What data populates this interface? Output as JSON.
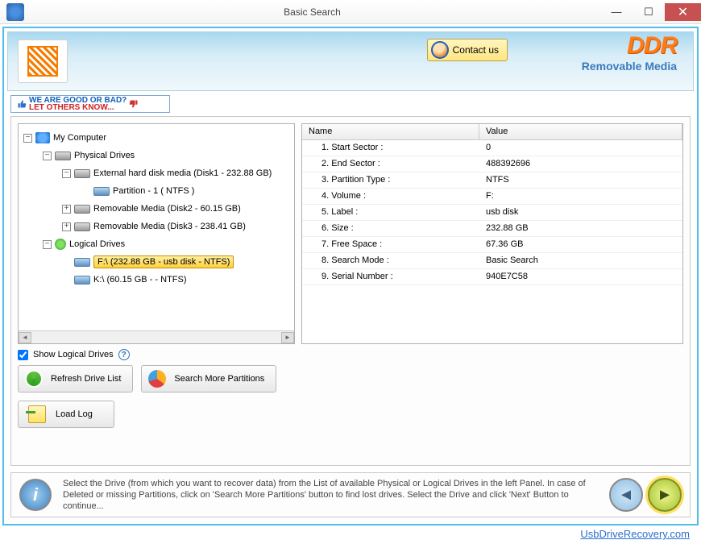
{
  "window": {
    "title": "Basic Search"
  },
  "header": {
    "contact_label": "Contact us",
    "brand": "DDR",
    "brand_sub": "Removable Media"
  },
  "feedback": {
    "line1": "WE ARE GOOD OR BAD?",
    "line2": "LET OTHERS KNOW..."
  },
  "tree": {
    "root": "My Computer",
    "physical": "Physical Drives",
    "disk1": "External hard disk media (Disk1 - 232.88 GB)",
    "disk1_part": "Partition - 1 ( NTFS )",
    "disk2": "Removable Media (Disk2 - 60.15 GB)",
    "disk3": "Removable Media (Disk3 - 238.41 GB)",
    "logical": "Logical Drives",
    "drive_f": "F:\\ (232.88 GB - usb disk - NTFS)",
    "drive_k": "K:\\ (60.15 GB -  - NTFS)"
  },
  "props": {
    "header_name": "Name",
    "header_value": "Value",
    "rows": [
      {
        "name": "1. Start Sector :",
        "value": "0"
      },
      {
        "name": "2. End Sector :",
        "value": "488392696"
      },
      {
        "name": "3. Partition Type :",
        "value": "NTFS"
      },
      {
        "name": "4. Volume :",
        "value": "F:"
      },
      {
        "name": "5. Label :",
        "value": "usb disk"
      },
      {
        "name": "6. Size :",
        "value": "232.88 GB"
      },
      {
        "name": "7. Free Space :",
        "value": "67.36 GB"
      },
      {
        "name": "8. Search Mode :",
        "value": "Basic Search"
      },
      {
        "name": "9. Serial Number :",
        "value": "940E7C58"
      }
    ]
  },
  "controls": {
    "show_logical": "Show Logical Drives",
    "refresh": "Refresh Drive List",
    "search_more": "Search More Partitions",
    "load_log": "Load Log"
  },
  "info": {
    "text": "Select the Drive (from which you want to recover data) from the List of available Physical or Logical Drives in the left Panel. In case of Deleted or missing Partitions, click on 'Search More Partitions' button to find lost drives. Select the Drive and click 'Next' Button to continue..."
  },
  "footer": {
    "url": "UsbDriveRecovery.com"
  }
}
